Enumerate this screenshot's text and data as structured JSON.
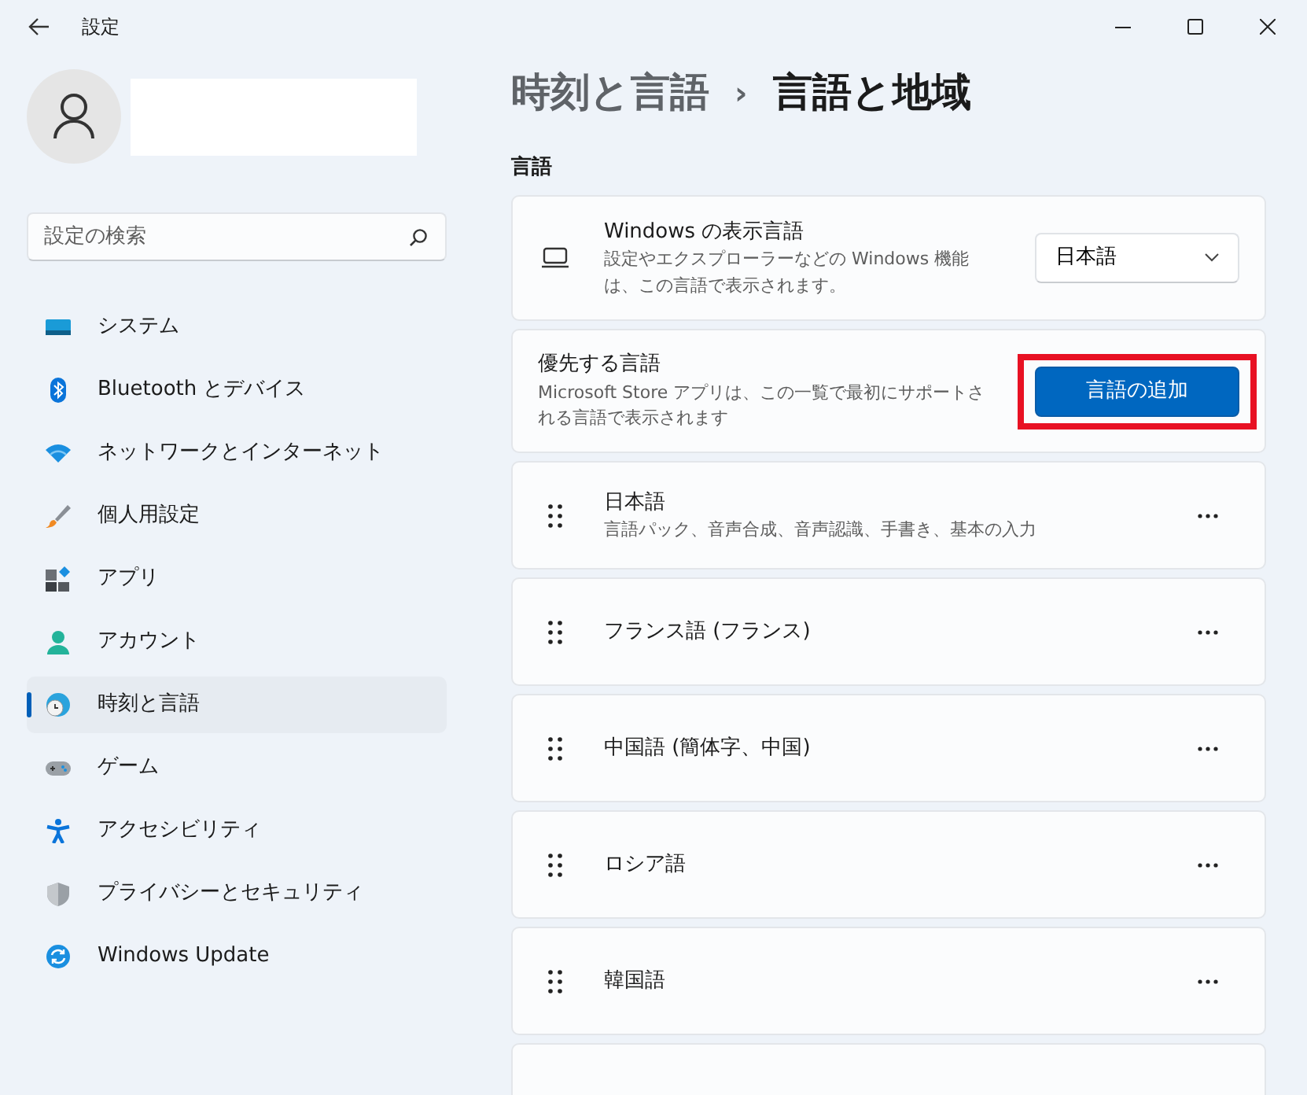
{
  "window": {
    "title": "設定"
  },
  "sidebar": {
    "search": {
      "placeholder": "設定の検索"
    },
    "items": [
      {
        "label": "システム",
        "selected": false
      },
      {
        "label": "Bluetooth とデバイス",
        "selected": false
      },
      {
        "label": "ネットワークとインターネット",
        "selected": false
      },
      {
        "label": "個人用設定",
        "selected": false
      },
      {
        "label": "アプリ",
        "selected": false
      },
      {
        "label": "アカウント",
        "selected": false
      },
      {
        "label": "時刻と言語",
        "selected": true
      },
      {
        "label": "ゲーム",
        "selected": false
      },
      {
        "label": "アクセシビリティ",
        "selected": false
      },
      {
        "label": "プライバシーとセキュリティ",
        "selected": false
      },
      {
        "label": "Windows Update",
        "selected": false
      }
    ]
  },
  "breadcrumb": {
    "parent": "時刻と言語",
    "separator": "›",
    "current": "言語と地域"
  },
  "section": {
    "heading": "言語"
  },
  "display_language": {
    "title": "Windows の表示言語",
    "description": "設定やエクスプローラーなどの Windows 機能は、この言語で表示されます。",
    "value": "日本語"
  },
  "preferred_languages": {
    "title": "優先する言語",
    "description": "Microsoft Store アプリは、この一覧で最初にサポートされる言語で表示されます",
    "button": "言語の追加",
    "highlighted": true
  },
  "languages": [
    {
      "name": "日本語",
      "details": "言語パック、音声合成、音声認識、手書き、基本の入力"
    },
    {
      "name": "フランス語 (フランス)"
    },
    {
      "name": "中国語 (簡体字、中国)"
    },
    {
      "name": "ロシア語"
    },
    {
      "name": "韓国語"
    }
  ]
}
